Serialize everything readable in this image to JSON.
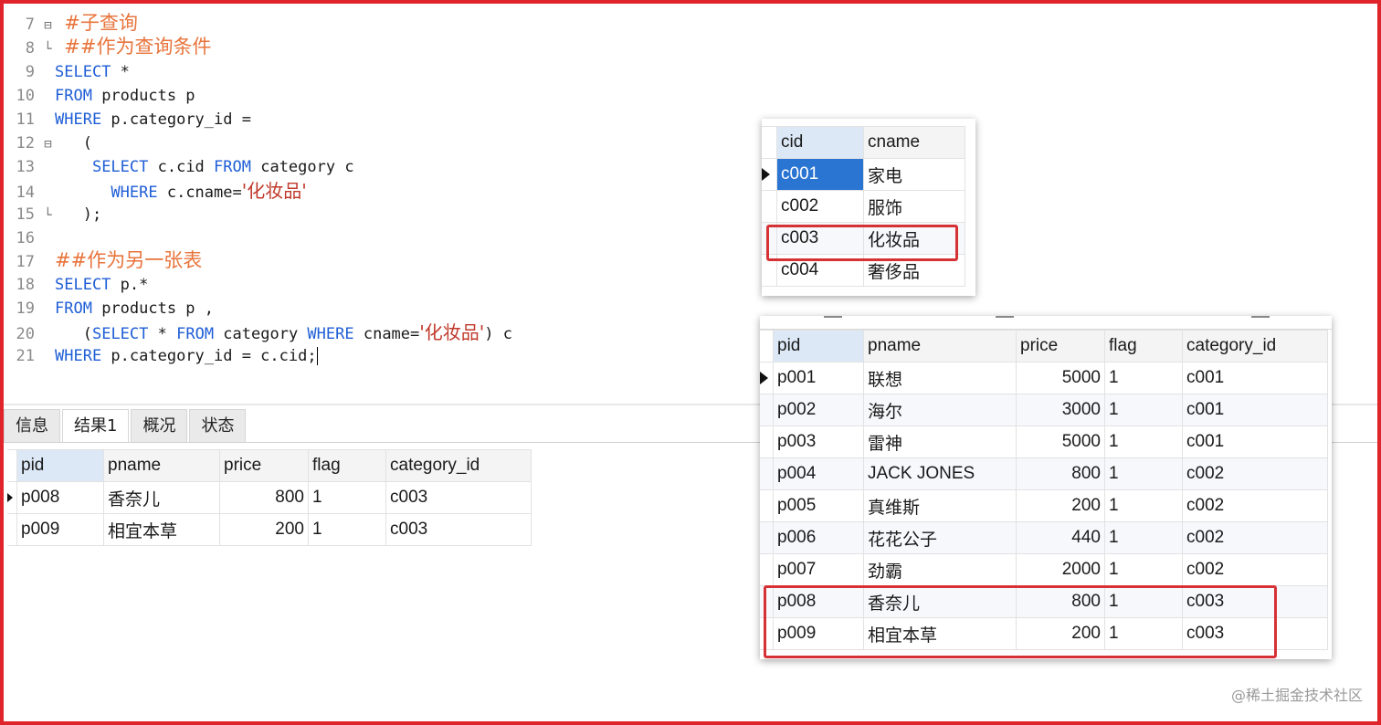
{
  "editor": {
    "l7": {
      "num": "7",
      "text": "#子查询"
    },
    "l8": {
      "num": "8",
      "text": "##作为查询条件"
    },
    "l9": {
      "num": "9",
      "kw": "SELECT",
      "rest": " *"
    },
    "l10": {
      "num": "10",
      "kw": "FROM",
      "rest": " products p"
    },
    "l11": {
      "num": "11",
      "kw": "WHERE",
      "rest": " p.category_id ="
    },
    "l12": {
      "num": "12",
      "text": "("
    },
    "l13": {
      "num": "13",
      "kw1": "SELECT",
      "mid": " c.cid ",
      "kw2": "FROM",
      "rest": " category c"
    },
    "l14": {
      "num": "14",
      "kw": "WHERE",
      "rest": " c.cname=",
      "str": "'化妆品'"
    },
    "l15": {
      "num": "15",
      "text": ");"
    },
    "l16": {
      "num": "16"
    },
    "l17": {
      "num": "17",
      "text": "##作为另一张表"
    },
    "l18": {
      "num": "18",
      "kw": "SELECT",
      "rest": " p.*"
    },
    "l19": {
      "num": "19",
      "kw": "FROM",
      "rest": " products p ,"
    },
    "l20": {
      "num": "20",
      "p1": "(",
      "kw1": "SELECT",
      "p2": " * ",
      "kw2": "FROM",
      "p3": " category ",
      "kw3": "WHERE",
      "p4": " cname=",
      "str": "'化妆品'",
      "p5": ") c"
    },
    "l21": {
      "num": "21",
      "kw": "WHERE",
      "rest": " p.category_id = c.cid;"
    }
  },
  "tabs": [
    "信息",
    "结果1",
    "概况",
    "状态"
  ],
  "result": {
    "headers": [
      "pid",
      "pname",
      "price",
      "flag",
      "category_id"
    ],
    "rows": [
      [
        "p008",
        "香奈儿",
        "800",
        "1",
        "c003"
      ],
      [
        "p009",
        "相宜本草",
        "200",
        "1",
        "c003"
      ]
    ]
  },
  "category_table": {
    "headers": [
      "cid",
      "cname"
    ],
    "rows": [
      [
        "c001",
        "家电"
      ],
      [
        "c002",
        "服饰"
      ],
      [
        "c003",
        "化妆品"
      ],
      [
        "c004",
        "奢侈品"
      ]
    ]
  },
  "products_table": {
    "headers": [
      "pid",
      "pname",
      "price",
      "flag",
      "category_id"
    ],
    "rows": [
      [
        "p001",
        "联想",
        "5000",
        "1",
        "c001"
      ],
      [
        "p002",
        "海尔",
        "3000",
        "1",
        "c001"
      ],
      [
        "p003",
        "雷神",
        "5000",
        "1",
        "c001"
      ],
      [
        "p004",
        "JACK JONES",
        "800",
        "1",
        "c002"
      ],
      [
        "p005",
        "真维斯",
        "200",
        "1",
        "c002"
      ],
      [
        "p006",
        "花花公子",
        "440",
        "1",
        "c002"
      ],
      [
        "p007",
        "劲霸",
        "2000",
        "1",
        "c002"
      ],
      [
        "p008",
        "香奈儿",
        "800",
        "1",
        "c003"
      ],
      [
        "p009",
        "相宜本草",
        "200",
        "1",
        "c003"
      ]
    ]
  },
  "watermark": "@稀土掘金技术社区",
  "colors": {
    "frame": "#e0242b",
    "highlight": "#d63236",
    "keyword": "#1f5ed6",
    "comment": "#e8743c",
    "string": "#c0392b",
    "selection": "#2a74d2"
  }
}
